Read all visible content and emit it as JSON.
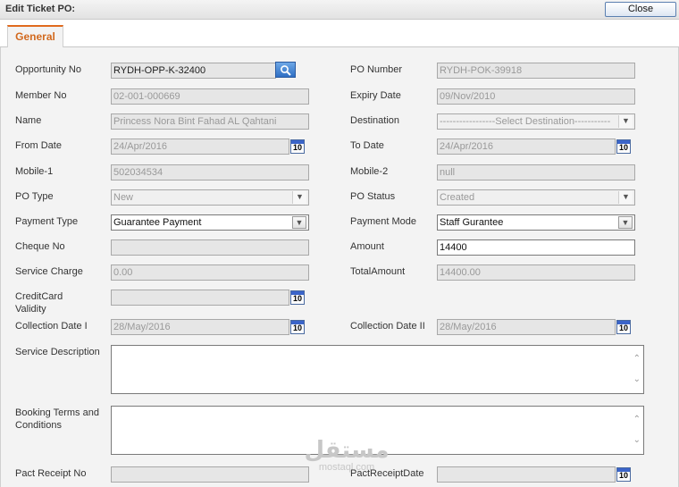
{
  "window": {
    "title": "Edit Ticket PO:",
    "close_label": "Close"
  },
  "tabs": [
    {
      "label": "General"
    }
  ],
  "form": {
    "opportunity_no": {
      "label": "Opportunity No",
      "value": "RYDH-OPP-K-32400"
    },
    "po_number": {
      "label": "PO Number",
      "value": "RYDH-POK-39918"
    },
    "member_no": {
      "label": "Member No",
      "value": "02-001-000669"
    },
    "expiry_date": {
      "label": "Expiry Date",
      "value": "09/Nov/2010"
    },
    "name": {
      "label": "Name",
      "value": "Princess Nora Bint Fahad AL Qahtani"
    },
    "destination": {
      "label": "Destination",
      "value": "-----------------Select Destination-----------"
    },
    "from_date": {
      "label": "From Date",
      "value": "24/Apr/2016"
    },
    "to_date": {
      "label": "To Date",
      "value": "24/Apr/2016"
    },
    "mobile_1": {
      "label": "Mobile-1",
      "value": "502034534"
    },
    "mobile_2": {
      "label": "Mobile-2",
      "value": "null"
    },
    "po_type": {
      "label": "PO Type",
      "value": "New"
    },
    "po_status": {
      "label": "PO Status",
      "value": "Created"
    },
    "payment_type": {
      "label": "Payment Type",
      "value": "Guarantee Payment"
    },
    "payment_mode": {
      "label": "Payment Mode",
      "value": "Staff Gurantee"
    },
    "cheque_no": {
      "label": "Cheque No",
      "value": ""
    },
    "amount": {
      "label": "Amount",
      "value": "14400"
    },
    "service_charge": {
      "label": "Service Charge",
      "value": "0.00"
    },
    "total_amount": {
      "label": "TotalAmount",
      "value": "14400.00"
    },
    "credit_card_validity": {
      "label_line1": "CreditCard",
      "label_line2": "Validity",
      "value": ""
    },
    "collection_date_1": {
      "label": "Collection Date I",
      "value": "28/May/2016"
    },
    "collection_date_2": {
      "label": "Collection Date II",
      "value": "28/May/2016"
    },
    "service_description": {
      "label": "Service Description",
      "value": ""
    },
    "booking_terms": {
      "label_line1": "Booking Terms and",
      "label_line2": "Conditions",
      "value": ""
    },
    "pact_receipt_no": {
      "label": "Pact Receipt No",
      "value": ""
    },
    "pact_receipt_date": {
      "label": "PactReceiptDate",
      "value": ""
    }
  },
  "calendar_day_label": "10",
  "icons": {
    "search": "search-icon",
    "calendar": "calendar-icon",
    "dropdown": "chevron-down-icon"
  },
  "colors": {
    "tab_accent": "#d2691e",
    "search_button": "#2f6fc4",
    "calendar_header": "#3b64c9"
  },
  "watermark": {
    "arabic": "مستقل",
    "latin": "mostaql.com"
  }
}
